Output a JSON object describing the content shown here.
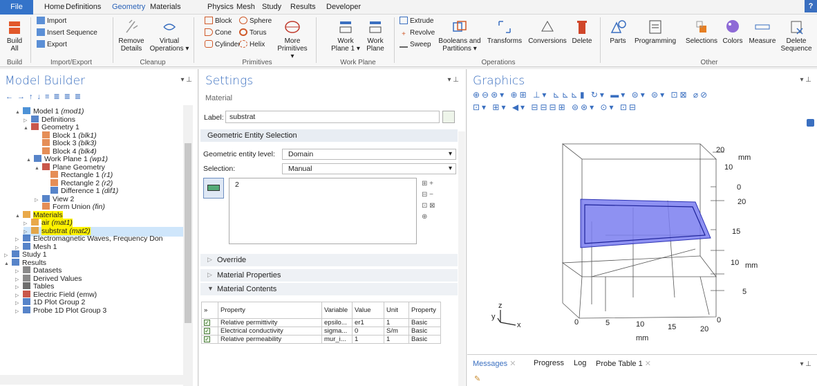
{
  "menu": {
    "file": "File",
    "tabs": [
      "Home",
      "Definitions",
      "Geometry",
      "Materials",
      "Physics",
      "Mesh",
      "Study",
      "Results",
      "Developer"
    ],
    "help": "?"
  },
  "ribbon": {
    "build": {
      "l1": "Build",
      "l2": "All"
    },
    "importexport": {
      "import": "Import",
      "insert": "Insert Sequence",
      "export": "Export"
    },
    "cleanup": {
      "remove1": "Remove",
      "remove2": "Details",
      "virtual1": "Virtual",
      "virtual2": "Operations ▾"
    },
    "primitives": {
      "block": "Block",
      "sphere": "Sphere",
      "cone": "Cone",
      "torus": "Torus",
      "cylinder": "Cylinder",
      "helix": "Helix",
      "more1": "More",
      "more2": "Primitives ▾"
    },
    "workplane": {
      "wp1a": "Work",
      "wp1b": "Plane 1 ▾",
      "wp2a": "Work",
      "wp2b": "Plane"
    },
    "ops": {
      "extrude": "Extrude",
      "revolve": "Revolve",
      "sweep": "Sweep",
      "booleans1": "Booleans and",
      "booleans2": "Partitions ▾",
      "transforms": "Transforms",
      "conversions": "Conversions",
      "delete": "Delete"
    },
    "other": {
      "parts": "Parts",
      "programming": "Programming",
      "selections": "Selections",
      "colors": "Colors",
      "measure": "Measure",
      "delseq1": "Delete",
      "delseq2": "Sequence"
    },
    "groups": {
      "build": "Build",
      "importexport": "Import/Export",
      "cleanup": "Cleanup",
      "primitives": "Primitives",
      "workplane": "Work Plane",
      "operations": "Operations",
      "other": "Other"
    }
  },
  "modelbuilder": {
    "title": "Model Builder",
    "tree": [
      {
        "t": "Model 1 ",
        "i": "(mod1)"
      },
      {
        "t": "Definitions",
        "i": ""
      },
      {
        "t": "Geometry 1",
        "i": ""
      },
      {
        "t": "Block 1 ",
        "i": "(blk1)"
      },
      {
        "t": "Block 3 ",
        "i": "(blk3)"
      },
      {
        "t": "Block 4 ",
        "i": "(blk4)"
      },
      {
        "t": "Work Plane 1 ",
        "i": "(wp1)"
      },
      {
        "t": "Plane Geometry",
        "i": ""
      },
      {
        "t": "Rectangle 1 ",
        "i": "(r1)"
      },
      {
        "t": "Rectangle 2 ",
        "i": "(r2)"
      },
      {
        "t": "Difference 1 ",
        "i": "(dif1)"
      },
      {
        "t": "View 2",
        "i": ""
      },
      {
        "t": "Form Union ",
        "i": "(fin)"
      },
      {
        "t": "Materials",
        "i": ""
      },
      {
        "t": "air ",
        "i": "(mat1)"
      },
      {
        "t": "substrat ",
        "i": "(mat2)"
      },
      {
        "t": "Electromagnetic Waves, Frequency Don",
        "i": ""
      },
      {
        "t": "Mesh 1",
        "i": ""
      },
      {
        "t": "Study 1",
        "i": ""
      },
      {
        "t": "Results",
        "i": ""
      },
      {
        "t": "Datasets",
        "i": ""
      },
      {
        "t": "Derived Values",
        "i": ""
      },
      {
        "t": "Tables",
        "i": ""
      },
      {
        "t": "Electric Field (emw)",
        "i": ""
      },
      {
        "t": "1D Plot Group 2",
        "i": ""
      },
      {
        "t": "Probe 1D Plot Group 3",
        "i": ""
      }
    ]
  },
  "settings": {
    "title": "Settings",
    "subtitle": "Material",
    "label_caption": "Label:",
    "label_value": "substrat",
    "ges": "Geometric Entity Selection",
    "gel_caption": "Geometric entity level:",
    "gel_value": "Domain",
    "sel_caption": "Selection:",
    "sel_value": "Manual",
    "sel_item": "2",
    "override": "Override",
    "matprops": "Material Properties",
    "matcontents": "Material Contents",
    "table": {
      "headers": [
        "Property",
        "Variable",
        "Value",
        "Unit",
        "Property"
      ],
      "rows": [
        [
          "Relative permittivity",
          "epsilo...",
          "er1",
          "1",
          "Basic"
        ],
        [
          "Electrical conductivity",
          "sigma...",
          "0",
          "S/m",
          "Basic"
        ],
        [
          "Relative permeability",
          "mur_i...",
          "1",
          "1",
          "Basic"
        ]
      ]
    }
  },
  "graphics": {
    "title": "Graphics",
    "ticks": {
      "r20": "20",
      "rmm": "mm",
      "r10": "10",
      "rz0": "0",
      "rz20": "20",
      "rz15": "15",
      "r10b": "10",
      "rmm2": "mm",
      "r5": "5",
      "r0": "0",
      "b0": "0",
      "b5": "5",
      "b10": "10",
      "b15": "15",
      "b20": "20",
      "bmm": "mm"
    },
    "axes": {
      "z": "z",
      "y": "y",
      "x": "x"
    }
  },
  "messages": {
    "tabs": [
      "Messages",
      "Progress",
      "Log",
      "Probe Table 1"
    ]
  },
  "colors": {
    "accent": "#3a6fc0",
    "highlight": "#fff200",
    "selection": "#7a7ef0"
  }
}
